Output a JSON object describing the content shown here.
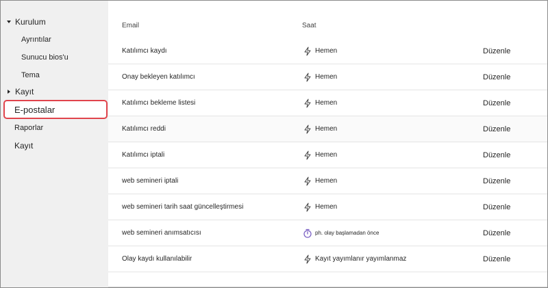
{
  "sidebar": {
    "items": [
      {
        "label": "Kurulum",
        "expanded": true
      },
      {
        "label": "Ayrıntılar"
      },
      {
        "label": "Sunucu bios'u"
      },
      {
        "label": "Tema"
      },
      {
        "label": "Kayıt",
        "expanded": false
      },
      {
        "label": "E-postalar",
        "selected": true
      },
      {
        "label": "Raporlar"
      },
      {
        "label": "Kayıt"
      }
    ]
  },
  "table": {
    "headers": {
      "email": "Email",
      "time": "Saat"
    },
    "rows": [
      {
        "email": "Katılımcı kaydı",
        "icon": "lightning-icon",
        "time": "Hemen",
        "action": "Düzenle"
      },
      {
        "email": "Onay bekleyen katılımcı",
        "icon": "lightning-icon",
        "time": "Hemen",
        "action": "Düzenle"
      },
      {
        "email": "Katılımcı bekleme listesi",
        "icon": "lightning-icon",
        "time": "Hemen",
        "action": "Düzenle"
      },
      {
        "email": "Katılımcı reddi",
        "icon": "lightning-icon",
        "time": "Hemen",
        "action": "Düzenle"
      },
      {
        "email": "Katılımcı iptali",
        "icon": "lightning-icon",
        "time": "Hemen",
        "action": "Düzenle"
      },
      {
        "email": "web semineri iptali",
        "icon": "lightning-icon",
        "time": "Hemen",
        "action": "Düzenle"
      },
      {
        "email": "web semineri tarih saat güncelleştirmesi",
        "icon": "lightning-icon",
        "time": "Hemen",
        "action": "Düzenle"
      },
      {
        "email": "web semineri anımsatıcısı",
        "icon": "timer-icon",
        "time": "ph. olay başlamadan önce",
        "action": "Düzenle"
      },
      {
        "email": "Olay kaydı kullanılabilir",
        "icon": "lightning-icon",
        "time": "Kayıt yayımlanır yayımlanmaz",
        "action": "Düzenle"
      }
    ]
  },
  "colors": {
    "sidebar_bg": "#f0f0f0",
    "selection_border": "#e0434b",
    "timer_icon": "#7b61c4"
  }
}
